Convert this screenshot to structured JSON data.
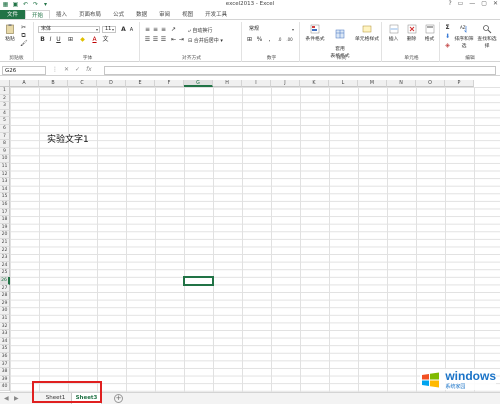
{
  "window": {
    "title": "excel2013 - Excel",
    "controls": [
      "?",
      "▭",
      "—",
      "▢",
      "✕"
    ]
  },
  "qat": [
    "save-icon",
    "undo-icon",
    "redo-icon",
    "customize-icon"
  ],
  "tabs": [
    {
      "label": "文件",
      "type": "file"
    },
    {
      "label": "开始",
      "type": "active"
    },
    {
      "label": "插入",
      "type": "normal"
    },
    {
      "label": "页面布局",
      "type": "normal"
    },
    {
      "label": "公式",
      "type": "normal"
    },
    {
      "label": "数据",
      "type": "normal"
    },
    {
      "label": "审阅",
      "type": "normal"
    },
    {
      "label": "视图",
      "type": "normal"
    },
    {
      "label": "开发工具",
      "type": "normal"
    }
  ],
  "ribbon": {
    "clipboard": {
      "label": "剪贴板",
      "paste": "粘贴"
    },
    "font": {
      "label": "字体",
      "font_name": "宋体",
      "font_size": "11",
      "bold": "B",
      "italic": "I",
      "underline": "U",
      "grow": "A",
      "shrink": "A",
      "font_color": "A"
    },
    "alignment": {
      "label": "对齐方式",
      "wrap": "自动换行",
      "merge": "合并后居中"
    },
    "number": {
      "label": "数字",
      "format": "常规"
    },
    "styles": {
      "label": "样式",
      "conditional": "条件格式",
      "table_format": "套用\n表格格式",
      "cell_styles": "单元格样式"
    },
    "cells": {
      "label": "单元格",
      "insert": "插入",
      "delete": "删除",
      "format": "格式"
    },
    "editing": {
      "label": "编辑",
      "sort": "排序和筛选",
      "find": "查找和选择",
      "sigma": "Σ"
    }
  },
  "formula_bar": {
    "name_box": "G26",
    "value": ""
  },
  "grid": {
    "columns": [
      "A",
      "B",
      "C",
      "D",
      "E",
      "F",
      "G",
      "H",
      "I",
      "J",
      "K",
      "L",
      "M",
      "N",
      "O",
      "P"
    ],
    "rows": [
      "1",
      "2",
      "3",
      "4",
      "5",
      "6",
      "7",
      "8",
      "9",
      "10",
      "11",
      "12",
      "13",
      "14",
      "15",
      "16",
      "17",
      "18",
      "19",
      "20",
      "21",
      "22",
      "23",
      "24",
      "25",
      "26",
      "27",
      "28",
      "29",
      "30",
      "31",
      "32",
      "33",
      "34",
      "35",
      "36",
      "37",
      "38",
      "39",
      "40"
    ],
    "selected_col": "G",
    "selected_row": "26",
    "cell_text": "实验文字1"
  },
  "sheets": [
    {
      "name": "Sheet1",
      "active": false
    },
    {
      "name": "Sheet3",
      "active": true
    }
  ],
  "accent_color": "#217346",
  "highlight_color": "#e02020",
  "watermark": {
    "brand": "windows",
    "sub": "系统家园"
  }
}
